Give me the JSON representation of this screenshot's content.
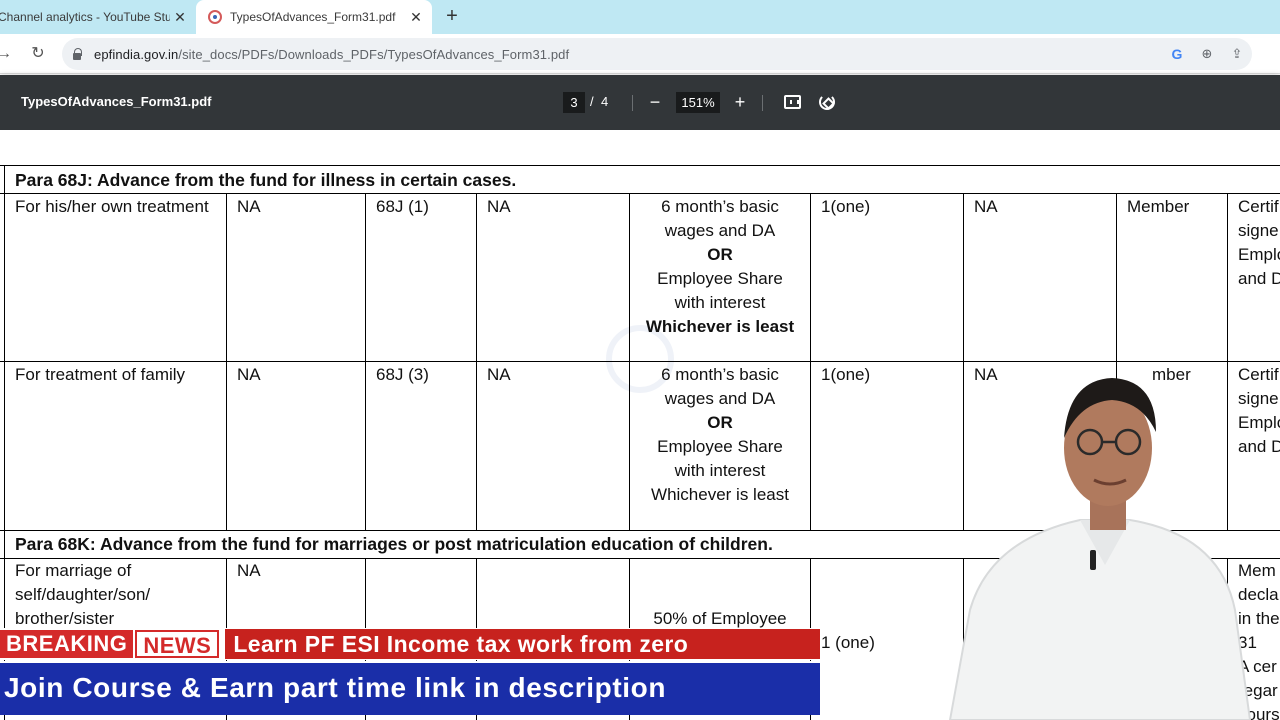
{
  "browser": {
    "tabs": [
      {
        "title": "Channel analytics - YouTube Stud",
        "active": false
      },
      {
        "title": "TypesOfAdvances_Form31.pdf",
        "active": true
      }
    ],
    "new_tab_icon": "+",
    "close_icon": "✕",
    "url_host": "epfindia.gov.in",
    "url_path": "/site_docs/PDFs/Downloads_PDFs/TypesOfAdvances_Form31.pdf"
  },
  "pdf": {
    "filename": "TypesOfAdvances_Form31.pdf",
    "page_current": "3",
    "page_sep": "/",
    "page_total": "4",
    "zoom": "151%",
    "zoom_out": "−",
    "zoom_in": "+"
  },
  "table": {
    "section1_title": "Para 68J:  Advance from the fund for illness in certain cases.",
    "row1": {
      "purpose": "For his/her own treatment",
      "col2": "NA",
      "para": "68J (1)",
      "col4": "NA",
      "amount_l1": "6 month’s basic",
      "amount_l2": "wages and DA",
      "amount_or": "OR",
      "amount_l3": "Employee Share",
      "amount_l4": "with interest",
      "amount_l5": "Whichever is least",
      "times": "1(one)",
      "col7": "NA",
      "col8": "Member",
      "col9_l1": "Certif",
      "col9_l2": "signe",
      "col9_l3": "Emplo",
      "col9_l4": "and D"
    },
    "row2": {
      "purpose": "For treatment of family",
      "col2": "NA",
      "para": "68J (3)",
      "col4": "NA",
      "amount_l1": "6 month’s basic",
      "amount_l2": "wages and DA",
      "amount_or": "OR",
      "amount_l3": "Employee Share",
      "amount_l4": "with interest",
      "amount_l5": "Whichever is least",
      "times": "1(one)",
      "col7": "NA",
      "col8": "mber",
      "col9_l1": "Certif",
      "col9_l2": "signe",
      "col9_l3": "Emplo",
      "col9_l4": "and D"
    },
    "section2_title": "Para 68K: Advance from the fund for marriages or post matriculation education of children.",
    "row3": {
      "purpose_l1": "For marriage of",
      "purpose_l2": "self/daughter/son/",
      "purpose_l3": "brother/sister",
      "col2": "NA",
      "amount_l1": "50% of Employee",
      "times": "1 (one)",
      "col9_l1": "Mem",
      "col9_l2": "decla",
      "col9_l3": "in the",
      "col9_l4": "31",
      "col9_l5": "A cer",
      "col9_l6": "regar",
      "col9_l7": "cours"
    }
  },
  "overlay": {
    "breaking": "BREAKING",
    "news": "NEWS",
    "headline": "Learn PF ESI Income tax work from zero",
    "subline": "Join Course & Earn part time link in description"
  },
  "colors": {
    "tabstrip": "#bfe8f3",
    "pdf_toolbar": "#323639",
    "breaking_red": "#d42a2a",
    "headline_red": "#c7221e",
    "subline_blue": "#1a2ea8"
  }
}
